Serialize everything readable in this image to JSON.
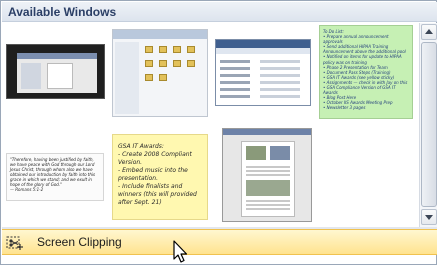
{
  "header": {
    "title": "Available Windows"
  },
  "thumbnails": {
    "green_note": {
      "text": "To Do List:\n• Prepare annual announcement approvals\n• Send additional HIPAA Training Announcement above the additional pool\n• Notified on items for update to HIPAA policy was on training\n• Phase 2 Presentation for Team\n• Document Pass Steps (Training)\n• GSA IT Awards (see yellow sticky)\n• Assignments — check in with Jay on this\n• GSA Compliance Version of GSA IT Awards\n• Blog Post Here\n• October IIS Awards Meeting Prep\n• Newsletter 3 pages"
    },
    "yellow_note": {
      "text": "GSA IT Awards:\n- Create 2008 Compliant Version.\n- Embed music into the presentation.\n- Include finalists and winners (this will provided after Sept. 21)"
    },
    "white_note": {
      "text": "\"Therefore, having been justified by faith, we have peace with God through our Lord Jesus Christ, through whom also we have obtained our introduction by faith into this grace in which we stand; and we exult in hope of the glory of God.\"\n— Romans 5:1-2"
    }
  },
  "clip_button": {
    "label": "Screen Clipping"
  }
}
